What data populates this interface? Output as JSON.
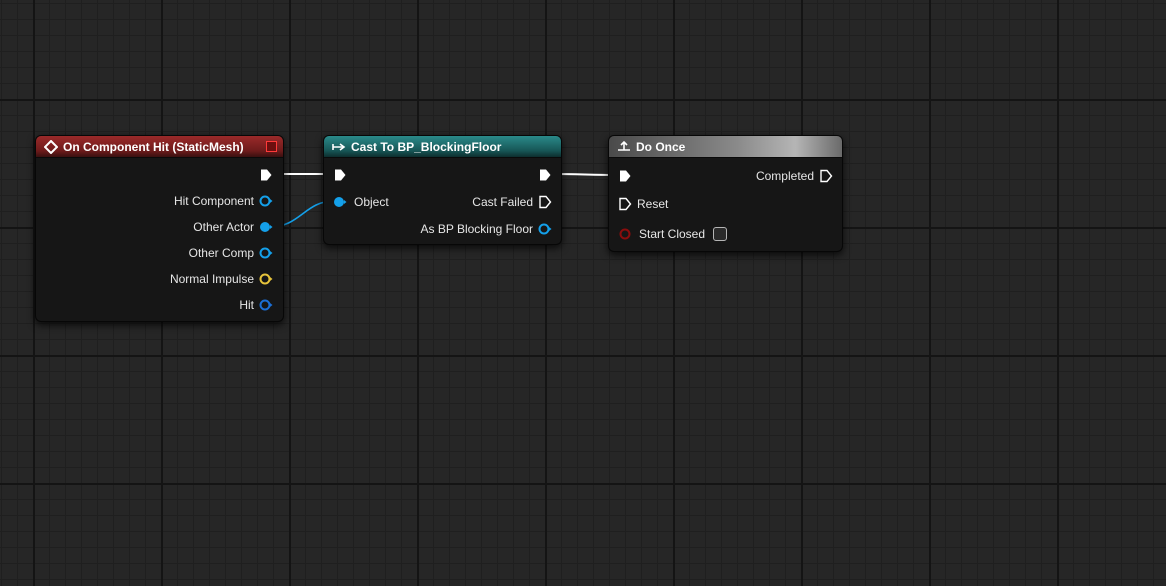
{
  "nodes": {
    "component_hit": {
      "title": "On Component Hit (StaticMesh)",
      "header_color": "#7a1f1f",
      "pins": {
        "hit_component": "Hit Component",
        "other_actor": "Other Actor",
        "other_comp": "Other Comp",
        "normal_impulse": "Normal Impulse",
        "hit": "Hit"
      }
    },
    "cast": {
      "title": "Cast To BP_BlockingFloor",
      "header_color": "#1b5d5d",
      "pins": {
        "object": "Object",
        "cast_failed": "Cast Failed",
        "as_bp": "As BP Blocking Floor"
      }
    },
    "do_once": {
      "title": "Do Once",
      "header_color": "#6b6b6b",
      "pins": {
        "completed": "Completed",
        "reset": "Reset",
        "start_closed": "Start Closed"
      }
    }
  },
  "colors": {
    "exec": "#ffffff",
    "object_pin": "#14a0ea",
    "vector_pin": "#e7c43b",
    "bool_pin": "#8b0d0d",
    "struct_pin": "#1b6fd6"
  },
  "icons": {
    "event": "diamond-event-icon",
    "cast": "cast-arrow-icon",
    "do_once": "do-once-icon",
    "delegate": "red-square-delegate-icon"
  }
}
